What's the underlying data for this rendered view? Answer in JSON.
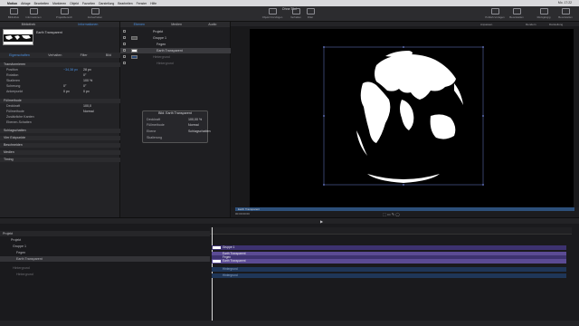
{
  "menubar": {
    "app_name": "Motion",
    "items": [
      "Ablage",
      "Bearbeiten",
      "Markieren",
      "Objekt",
      "Favoriten",
      "Darstellung",
      "Bearbeiten",
      "Fenster",
      "Hilfe"
    ],
    "status": "Mo. 17:22"
  },
  "window": {
    "title": "Ohne Titel"
  },
  "toolbar": {
    "left_buttons": [
      "Bibliothek",
      "Informationen",
      "Projektbereich",
      "Zeitverhalten"
    ],
    "center_buttons": [
      "Objekt hinzufügen",
      "Verhalten",
      "Filter"
    ],
    "right_buttons": [
      "Publish-Vorlagen",
      "Bereitstellen",
      "Rückgängig",
      "Bereitstellen"
    ]
  },
  "library": {
    "tabs": [
      "Bibliothek",
      "Informationen"
    ],
    "active_tab": "Informationen",
    "preview_name": "Earth Transparent"
  },
  "inspector": {
    "tabs": [
      "Eigenschaften",
      "Verhalten",
      "Filter",
      "Bild"
    ],
    "active_tab": "Eigenschaften",
    "transform_header": "Transformieren",
    "rows": [
      {
        "label": "Position",
        "x": "X",
        "xval": "−34,38 px",
        "y": "Y",
        "yval": "28 px"
      },
      {
        "label": "Rotation",
        "xval": "0°"
      },
      {
        "label": "Skalieren",
        "xval": "100 %"
      },
      {
        "label": "Scherung",
        "xval": "0°",
        "yval": "0°"
      },
      {
        "label": "Ankerpunkt",
        "xval": "0 px",
        "yval": "0 px"
      }
    ],
    "compositing_header": "Füllmethode",
    "comp_rows": [
      {
        "label": "Deckkraft",
        "val": "100,0"
      },
      {
        "label": "Füllmethode",
        "val": "Normal"
      },
      {
        "label": "Zusätzliche Kanten",
        "val": ""
      },
      {
        "label": "Ebenen-Schatten",
        "val": ""
      }
    ],
    "sections": [
      "Schlagschatten",
      "Vier Eckpunkte",
      "Beschneiden",
      "Medien",
      "Timing"
    ]
  },
  "layers_panel": {
    "tabs": [
      "Ebenen",
      "Medien",
      "Audio"
    ],
    "active_tab": "Ebenen",
    "rows": [
      {
        "name": "Projekt",
        "indent": 0,
        "selected": false
      },
      {
        "name": "Gruppe 1",
        "indent": 1,
        "selected": false
      },
      {
        "name": "Fegen",
        "indent": 2,
        "selected": false
      },
      {
        "name": "Earth Transparent",
        "indent": 2,
        "selected": true
      },
      {
        "name": "Hintergrund",
        "indent": 1,
        "selected": false
      },
      {
        "name": "Hintergrund",
        "indent": 2,
        "selected": false
      }
    ]
  },
  "hud": {
    "title": "Bild: Earth Transparent",
    "rows": [
      {
        "label": "Deckkraft",
        "value": "100,00 %"
      },
      {
        "label": "Füllmethode",
        "value": "Normal"
      },
      {
        "label": "Ebene",
        "value": "Schlagschatten"
      },
      {
        "label": "Skalierung",
        "value": ""
      }
    ]
  },
  "canvas": {
    "status_right": [
      "Anpassen",
      "Rendern",
      "Darstellung"
    ],
    "selected_layer_label": "Earth Transparent",
    "timecode": "00:00:00:00"
  },
  "timeline": {
    "header": "Projekt",
    "rows": [
      {
        "name": "Projekt"
      },
      {
        "name": "Gruppe 1"
      },
      {
        "name": "Fegen"
      },
      {
        "name": "Earth Transparent"
      },
      {
        "name": "Hintergrund"
      },
      {
        "name": "Hintergrund"
      }
    ],
    "bars": [
      {
        "label": "Gruppe 1",
        "color": "#3d3270"
      },
      {
        "label": "Earth Transparent",
        "color": "#5b4b94"
      },
      {
        "label": "Fegen",
        "color": "#3d3270"
      },
      {
        "label": "Earth Transparent",
        "color": "#5b4b94"
      },
      {
        "label": "Hintergrund",
        "color": "#1f3658"
      },
      {
        "label": "Hintergrund",
        "color": "#1f3658"
      }
    ]
  }
}
